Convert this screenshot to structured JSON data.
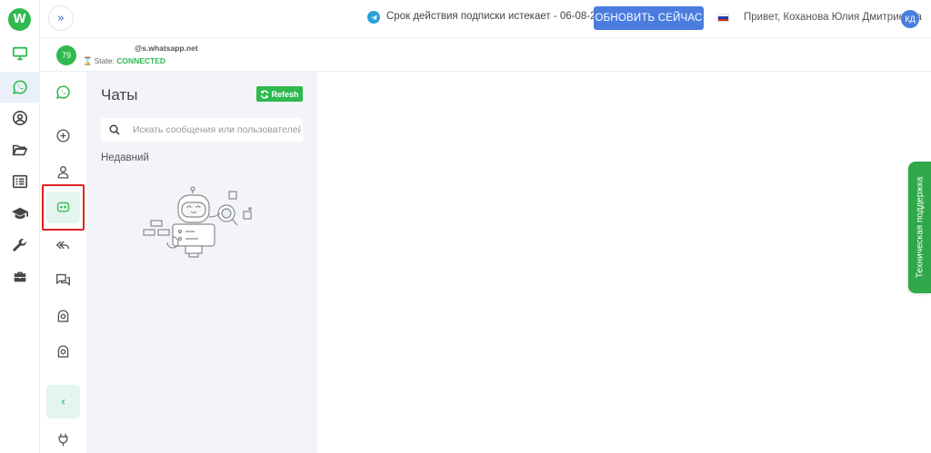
{
  "rail": {
    "logo": "W",
    "items": [
      {
        "name": "monitor-icon"
      },
      {
        "name": "whatsapp-icon"
      },
      {
        "name": "user-circle-icon"
      },
      {
        "name": "folder-icon"
      },
      {
        "name": "list-icon"
      },
      {
        "name": "graduation-cap-icon"
      },
      {
        "name": "wrench-icon"
      },
      {
        "name": "briefcase-icon"
      }
    ]
  },
  "topbar": {
    "subscription_text": "Срок действия подписки истекает - 06-08-2022",
    "renew_label": "ОБНОВИТЬ СЕЙЧАС",
    "greeting": "Привет, Коханова Юлия Дмитриевна",
    "avatar_initials": "КД"
  },
  "account": {
    "badge": "79",
    "number": "@s.whatsapp.net",
    "state_label": "State:",
    "state_value": "CONNECTED"
  },
  "chats": {
    "title": "Чаты",
    "refresh_label": "Refesh",
    "search_placeholder": "Искать сообщения или пользователей",
    "recent_label": "Недавний"
  },
  "support": {
    "label": "Техническая поддержка"
  },
  "colors": {
    "accent_green": "#2fb94f",
    "accent_blue": "#4b7de0",
    "highlight_red": "#e02020"
  }
}
